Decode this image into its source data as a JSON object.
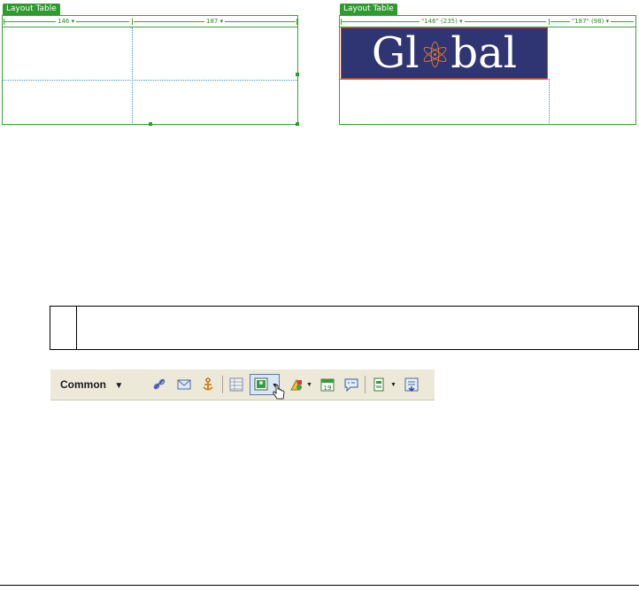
{
  "left_table": {
    "tab_label": "Layout Table",
    "col1_label": "146 ▾",
    "col2_label": "187 ▾"
  },
  "right_table": {
    "tab_label": "Layout Table",
    "col1_label": "\"146\" (235) ▾",
    "col2_label": "\"187\" (98) ▾",
    "logo_text_left": "Gl",
    "logo_text_right": "bal"
  },
  "toolbar": {
    "category_label": "Common",
    "dropdown_glyph": "▼",
    "icons": [
      "hyperlink-icon",
      "email-link-icon",
      "named-anchor-icon",
      "table-icon",
      "image-icon",
      "media-icon",
      "date-icon",
      "comment-icon",
      "templates-icon",
      "tag-chooser-icon"
    ]
  },
  "colors": {
    "layout_green": "#2f9a2f",
    "cell_blue": "#3a8fd8",
    "logo_bg": "#2f3473",
    "toolbar_bg": "#ece9d8"
  }
}
